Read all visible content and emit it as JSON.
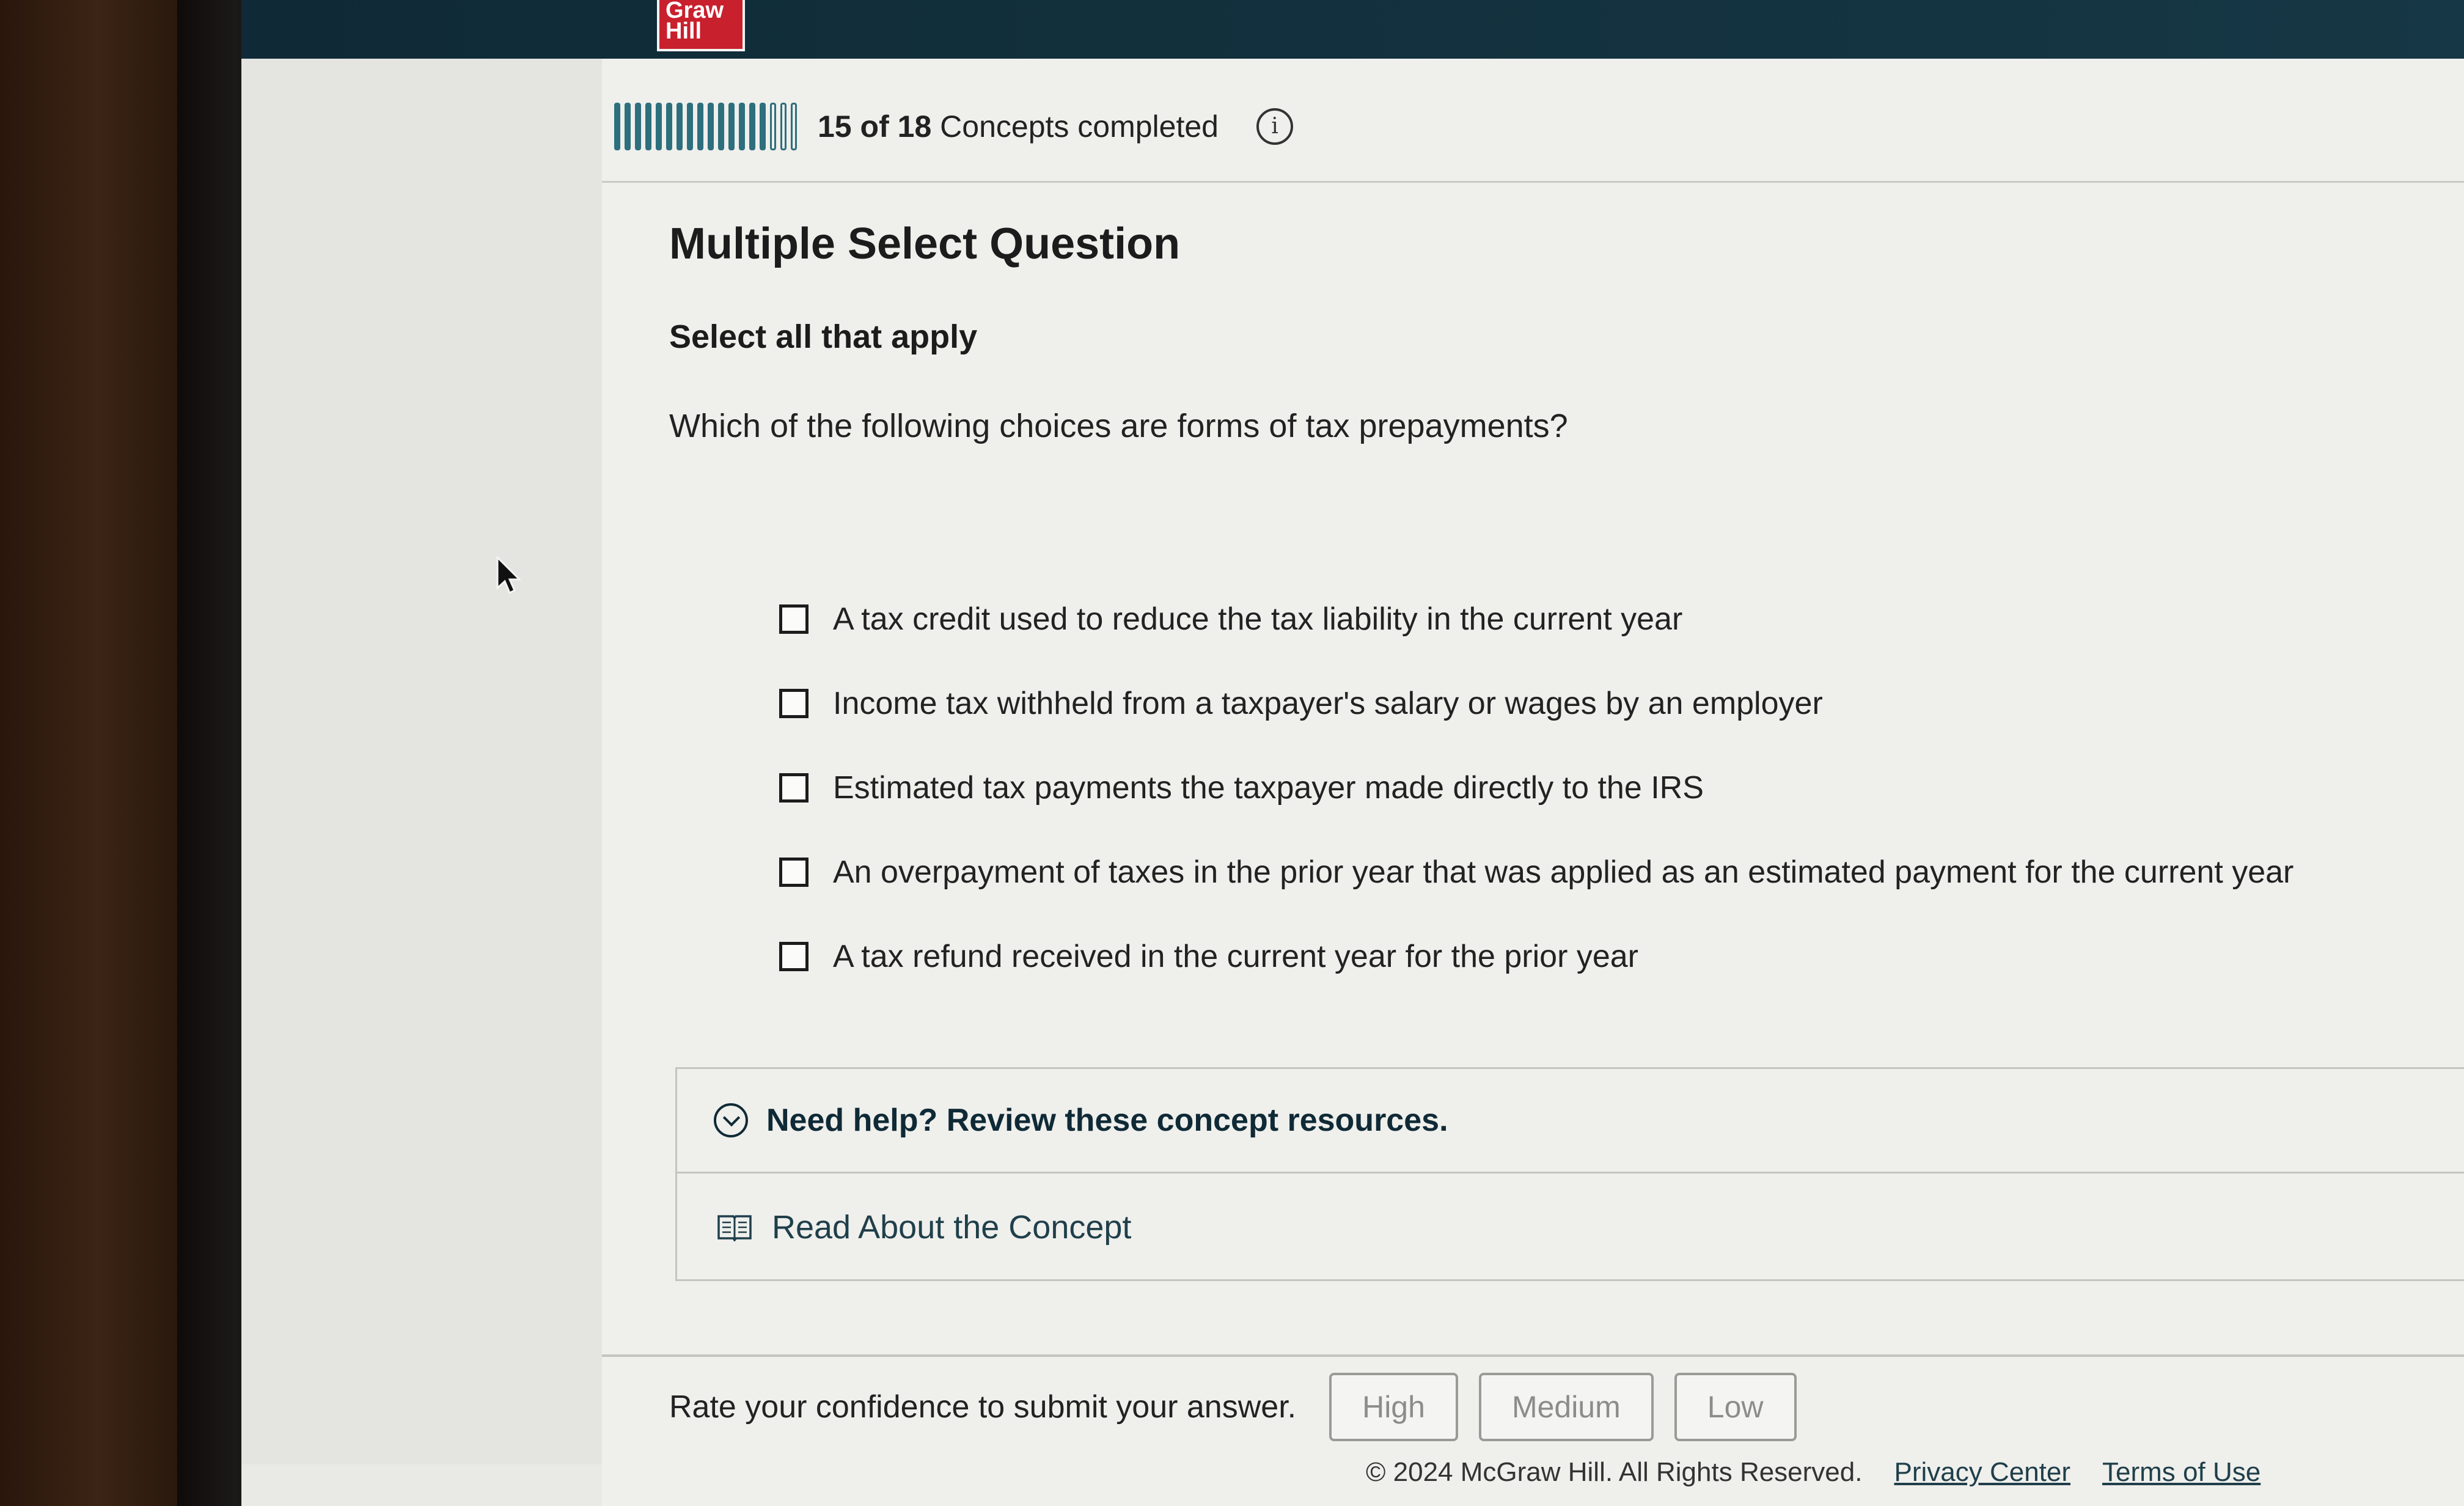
{
  "brand": {
    "logo_line1": "Graw",
    "logo_line2": "Hill"
  },
  "progress": {
    "completed": "15",
    "of_word": "of",
    "total": "18",
    "suffix": "Concepts completed",
    "fraction": 0.833
  },
  "question": {
    "type": "Multiple Select Question",
    "instruction": "Select all that apply",
    "prompt": "Which of the following choices are forms of tax prepayments?",
    "choices": [
      {
        "label": "A tax credit used to reduce the tax liability in the current year",
        "checked": false
      },
      {
        "label": "Income tax withheld from a taxpayer's salary or wages by an employer",
        "checked": false
      },
      {
        "label": "Estimated tax payments the taxpayer made directly to the IRS",
        "checked": false
      },
      {
        "label": "An overpayment of taxes in the prior year that was applied as an estimated payment for the current year",
        "checked": false
      },
      {
        "label": "A tax refund received in the current year for the prior year",
        "checked": false
      }
    ]
  },
  "help": {
    "title": "Need help? Review these concept resources.",
    "link_label": "Read About the Concept"
  },
  "confidence": {
    "label": "Rate your confidence to submit your answer.",
    "high": "High",
    "medium": "Medium",
    "low": "Low"
  },
  "footer": {
    "copyright": "© 2024 McGraw Hill. All Rights Reserved.",
    "privacy": "Privacy Center",
    "terms": "Terms of Use"
  },
  "colors": {
    "accent": "#2d6f7d",
    "topbar": "#0f2a36",
    "logo_red": "#c8202d"
  }
}
